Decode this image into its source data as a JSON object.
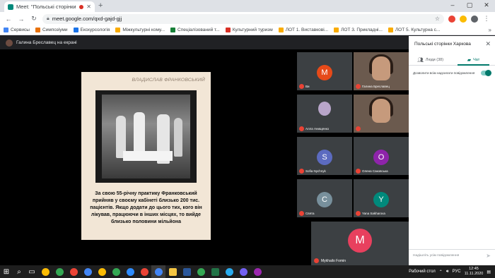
{
  "browser": {
    "tab_title": "Meet: \"Польські сторінки Х",
    "new_tab": "+",
    "url": "meet.google.com/qxd-gajd-gjj",
    "bookmarks": [
      {
        "label": "Сервисы",
        "color": "#4285f4"
      },
      {
        "label": "Симпозіуми",
        "color": "#e8710a"
      },
      {
        "label": "Екскурсологія",
        "color": "#1a73e8"
      },
      {
        "label": "Міжкультурні кому...",
        "color": "#f9ab00"
      },
      {
        "label": "Спеціалізований т...",
        "color": "#188038"
      },
      {
        "label": "Культурний туризм",
        "color": "#d93025"
      },
      {
        "label": "ЛОТ 1. Виставкові...",
        "color": "#f9ab00"
      },
      {
        "label": "ЛОТ 3. Прикладні...",
        "color": "#f9ab00"
      },
      {
        "label": "ЛОТ 5. Культурна с...",
        "color": "#f9ab00"
      }
    ]
  },
  "meet": {
    "presenter_label": "Галина Бреславец на екрані",
    "slide": {
      "author": "ВЛАДИСЛАВ ФРАНКОВСЬКИЙ",
      "caption": "За свою 55-річну практику Франковський прийняв у своєму кабінеті близько 200 тис. пацієнтів. Якщо додати до цього тих, кого він лікував, працюючи в інших місцях, то вийде близько половини мільйона"
    },
    "participants": [
      {
        "name": "Ви",
        "initial": "M",
        "color": "#e64a19",
        "type": "avatar"
      },
      {
        "name": "Галина Бреславец",
        "initial": "",
        "color": "",
        "type": "video"
      },
      {
        "name": "Алла Анищенко",
        "initial": "",
        "color": "#b8a5c9",
        "type": "photo"
      },
      {
        "name": "",
        "initial": "",
        "color": "",
        "type": "video"
      },
      {
        "name": "Sofia Nychnyk",
        "initial": "S",
        "color": "#5c6bc0",
        "type": "avatar"
      },
      {
        "name": "Олена Саковська",
        "initial": "O",
        "color": "#8e24aa",
        "type": "avatar"
      },
      {
        "name": "Свята",
        "initial": "C",
        "color": "#78909c",
        "type": "avatar"
      },
      {
        "name": "Yana Sakharova",
        "initial": "Y",
        "color": "#00897b",
        "type": "avatar"
      }
    ],
    "featured": {
      "name": "Mykhailo Fomin",
      "initial": "M",
      "color": "#e8405e"
    }
  },
  "panel": {
    "title": "Польські сторінки Харкова",
    "tab_people": "Люди (38)",
    "tab_chat": "Чат",
    "toggle_label": "Дозволити всім надсилати повідомлення",
    "toggle_on": true,
    "message_placeholder": "Надішліть усім повідомлення"
  },
  "taskbar": {
    "apps": [
      {
        "name": "chrome",
        "color": "#fbbc04"
      },
      {
        "name": "chrome",
        "color": "#34a853"
      },
      {
        "name": "chrome",
        "color": "#ea4335"
      },
      {
        "name": "chrome",
        "color": "#4285f4"
      },
      {
        "name": "chrome",
        "color": "#fbbc04"
      },
      {
        "name": "chrome",
        "color": "#34a853"
      },
      {
        "name": "zoom",
        "color": "#2d8cff"
      },
      {
        "name": "chrome",
        "color": "#ea4335"
      },
      {
        "name": "chrome-active",
        "color": "#4285f4"
      },
      {
        "name": "folder",
        "color": "#f4c542"
      },
      {
        "name": "word",
        "color": "#2b579a"
      },
      {
        "name": "chrome",
        "color": "#34a853"
      },
      {
        "name": "excel",
        "color": "#217346"
      },
      {
        "name": "telegram",
        "color": "#2aabee"
      },
      {
        "name": "viber",
        "color": "#7360f2"
      },
      {
        "name": "app",
        "color": "#9c27b0"
      }
    ],
    "desktop_label": "Рабочий стол",
    "language": "РУС",
    "time": "12:45",
    "date": "11.11.2020"
  }
}
